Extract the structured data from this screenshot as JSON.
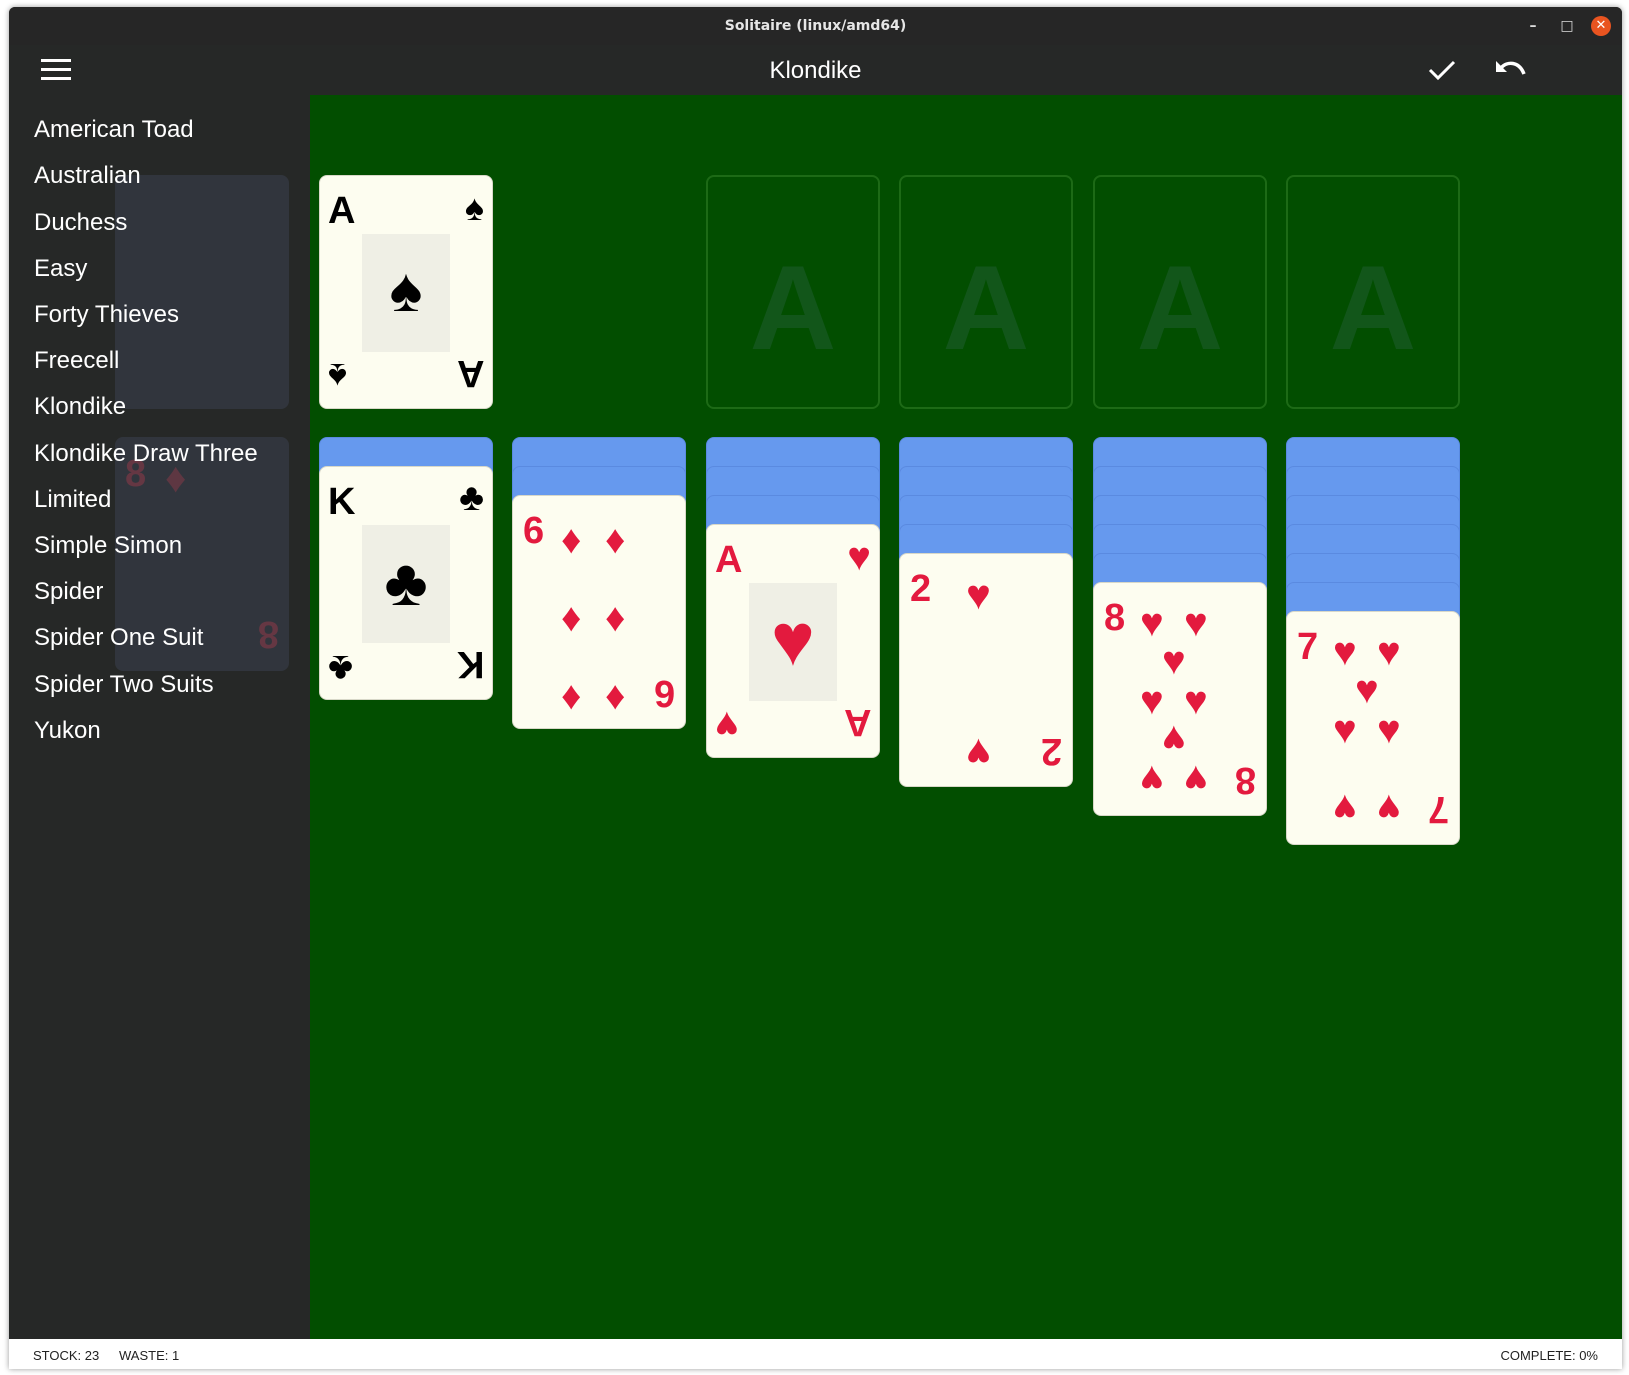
{
  "window": {
    "title": "Solitaire (linux/amd64)",
    "close_color": "#e95420"
  },
  "appbar": {
    "title": "Klondike",
    "menu_icon": "hamburger-icon",
    "check_icon": "checkmark-icon",
    "undo_icon": "undo-icon"
  },
  "sidebar": {
    "items": [
      {
        "label": "American Toad"
      },
      {
        "label": "Australian"
      },
      {
        "label": "Duchess"
      },
      {
        "label": "Easy"
      },
      {
        "label": "Forty Thieves"
      },
      {
        "label": "Freecell"
      },
      {
        "label": "Klondike"
      },
      {
        "label": "Klondike Draw Three"
      },
      {
        "label": "Limited"
      },
      {
        "label": "Simple Simon"
      },
      {
        "label": "Spider"
      },
      {
        "label": "Spider One Suit"
      },
      {
        "label": "Spider Two Suits"
      },
      {
        "label": "Yukon"
      }
    ]
  },
  "board": {
    "background": "#024e00",
    "card_back_color": "#6699ee",
    "waste": {
      "rank": "A",
      "suit": "♠",
      "color": "black"
    },
    "foundations": [
      {
        "label": "A"
      },
      {
        "label": "A"
      },
      {
        "label": "A"
      },
      {
        "label": "A"
      }
    ],
    "tableau": [
      {
        "face_down": 1,
        "top": {
          "rank": "K",
          "suit": "♣"
        }
      },
      {
        "face_down": 2,
        "top": {
          "rank": "6",
          "suit": "♦"
        }
      },
      {
        "face_down": 3,
        "top": {
          "rank": "A",
          "suit": "♥"
        }
      },
      {
        "face_down": 4,
        "top": {
          "rank": "2",
          "suit": "♥"
        }
      },
      {
        "face_down": 5,
        "top": {
          "rank": "8",
          "suit": "♥"
        }
      },
      {
        "face_down": 6,
        "top": {
          "rank": "7",
          "suit": "♥"
        }
      }
    ],
    "ghost_card": {
      "rank": "8",
      "suit": "♦"
    }
  },
  "status": {
    "stock": "STOCK: 23",
    "waste": "WASTE: 1",
    "complete": "COMPLETE: 0%"
  }
}
